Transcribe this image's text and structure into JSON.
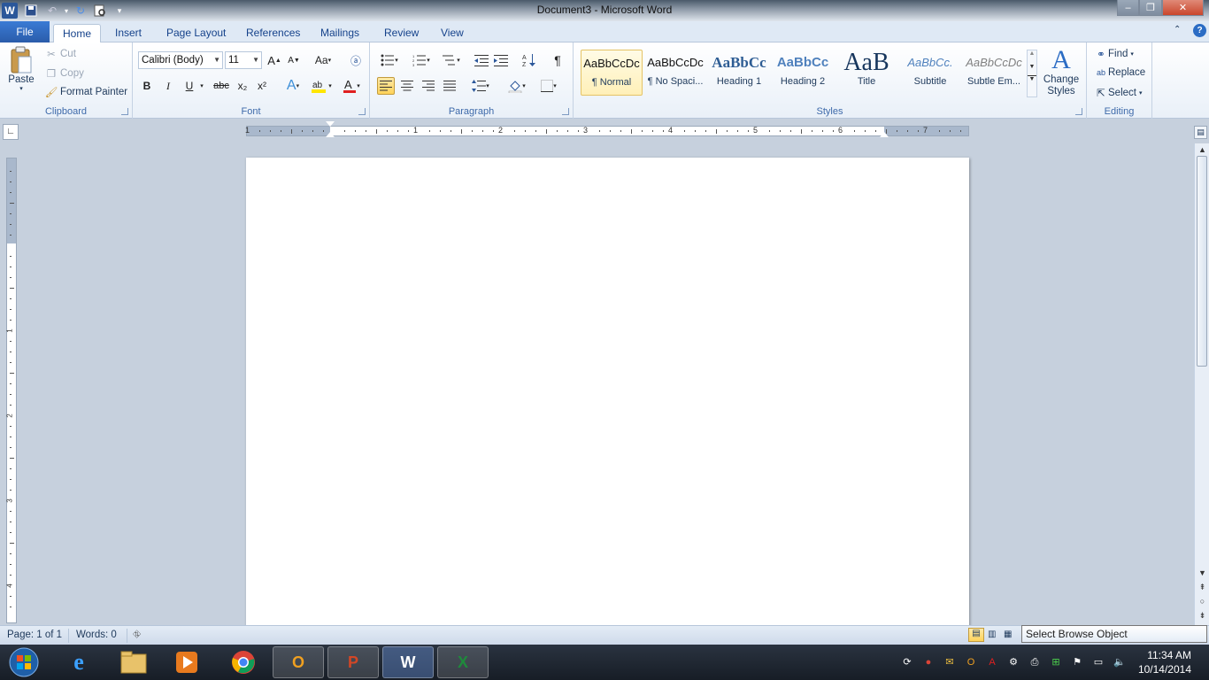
{
  "window": {
    "title": "Document3 - Microsoft Word",
    "min_glyph": "–",
    "max_glyph": "❐",
    "close_glyph": "✕"
  },
  "tabs": {
    "file": "File",
    "items": [
      "Home",
      "Insert",
      "Page Layout",
      "References",
      "Mailings",
      "Review",
      "View"
    ]
  },
  "clipboard": {
    "paste": "Paste",
    "cut": "Cut",
    "copy": "Copy",
    "format_painter": "Format Painter",
    "label": "Clipboard"
  },
  "font": {
    "family": "Calibri (Body)",
    "size": "11",
    "label": "Font",
    "grow": "A",
    "shrink": "A",
    "case": "Aa",
    "bold": "B",
    "italic": "I",
    "underline": "U",
    "strike": "abc",
    "subscript": "x₂",
    "superscript": "x²"
  },
  "paragraph": {
    "label": "Paragraph",
    "pilcrow": "¶"
  },
  "styles": {
    "label": "Styles",
    "items": [
      {
        "sample": "AaBbCcDc",
        "name": "¶ Normal"
      },
      {
        "sample": "AaBbCcDc",
        "name": "¶ No Spaci..."
      },
      {
        "sample": "AaBbCc",
        "name": "Heading 1"
      },
      {
        "sample": "AaBbCc",
        "name": "Heading 2"
      },
      {
        "sample": "AaB",
        "name": "Title"
      },
      {
        "sample": "AaBbCc.",
        "name": "Subtitle"
      },
      {
        "sample": "AaBbCcDc",
        "name": "Subtle Em..."
      }
    ],
    "change_styles": "Change Styles"
  },
  "editing": {
    "label": "Editing",
    "find": "Find",
    "replace": "Replace",
    "select": "Select"
  },
  "ruler": {
    "numbers": [
      "1",
      "1",
      "2",
      "3",
      "4",
      "5",
      "6",
      "7"
    ],
    "vnumbers": [
      "1",
      "2",
      "3",
      "4"
    ]
  },
  "status": {
    "page": "Page: 1 of 1",
    "words": "Words: 0",
    "tooltip": "Select Browse Object (Alt+Ctrl+Home)"
  },
  "taskbar": {
    "time": "11:34 AM",
    "date": "10/14/2014"
  },
  "colors": {
    "accent": "#2b579a",
    "file_tab": "#2a5caa",
    "highlight": "#ffd35a",
    "font_color": "#e02020"
  }
}
